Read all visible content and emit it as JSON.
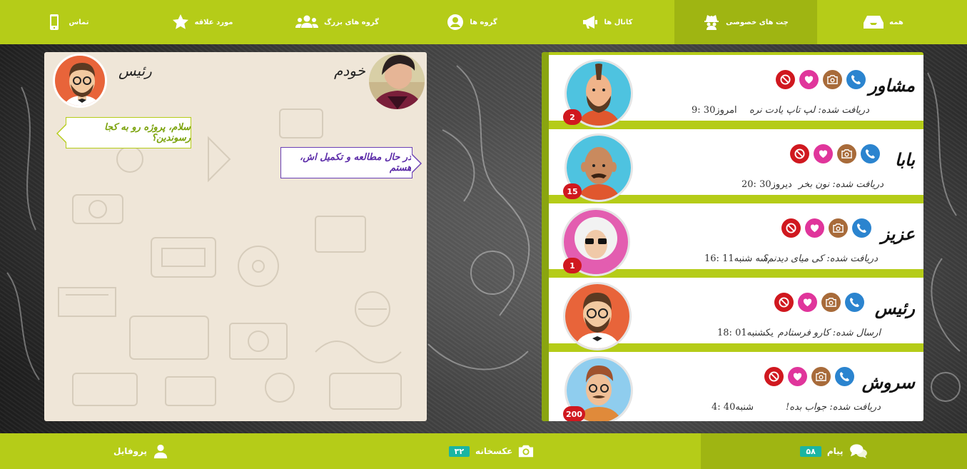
{
  "colors": {
    "accent": "#b5cc18",
    "accent_dark": "#9fb512",
    "badge": "#1ab5a3",
    "unread": "#d0181f"
  },
  "topnav": {
    "items": [
      {
        "label": "تماس",
        "icon": "phone-icon"
      },
      {
        "label": "مورد علاقه",
        "icon": "star-icon"
      },
      {
        "label": "گروه های بزرگ",
        "icon": "users-icon"
      },
      {
        "label": "گروه ها",
        "icon": "user-circle-icon"
      },
      {
        "label": "کانال ها",
        "icon": "megaphone-icon"
      },
      {
        "label": "چت های خصوصی",
        "icon": "spy-icon",
        "active": true
      },
      {
        "label": "همه",
        "icon": "inbox-icon"
      }
    ]
  },
  "chat": {
    "me_name": "خودم",
    "contact_name": "رئیس",
    "messages": [
      {
        "side": "left",
        "text": "سلام، پروژه رو به کجا رسوندین؟"
      },
      {
        "side": "right",
        "text": "در حال مطالعه و تکمیل اش، هستم"
      }
    ]
  },
  "contacts": [
    {
      "name": "مشاور",
      "last": "دریافت شده: لپ تاپ یادت نره",
      "time": "امروز30 :9",
      "unread": "2"
    },
    {
      "name": "بابا",
      "last": "دریافت شده: نون بخر",
      "time": "دیروز30 :20",
      "unread": "15"
    },
    {
      "name": "عزیز",
      "last": "دریافت شده: کی میای دیدنم؟",
      "time": "سه شنبه11 :16",
      "unread": "1"
    },
    {
      "name": "رئیس",
      "last": "ارسال شده: کارو فرستادم",
      "time": "یکشنبه01 :18",
      "unread": ""
    },
    {
      "name": "سروش",
      "last": "دریافت شده: جواب بده!",
      "time": "شنبه40 :4",
      "unread": "200"
    }
  ],
  "bottombar": {
    "profile_label": "پروفایل",
    "gallery_label": "عکسخانه",
    "gallery_count": "۳۲",
    "messages_label": "پیام",
    "messages_count": "۵۸"
  }
}
